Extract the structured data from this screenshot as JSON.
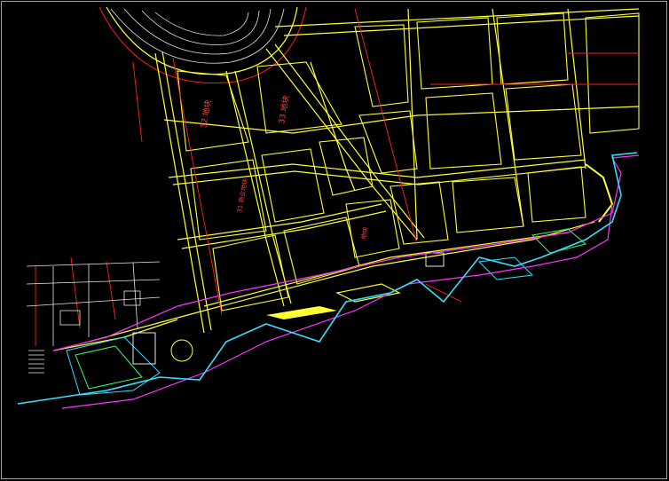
{
  "canvas": {
    "background": "#000000",
    "frame_color": "#00e5e5"
  },
  "colors": {
    "road_primary": "#ffff33",
    "road_secondary": "#e8e8e8",
    "plot_boundary": "#ff2020",
    "shoreline_outer": "#33e0ff",
    "shoreline_inner": "#ff33ff",
    "park_green": "#33ff66"
  },
  "labels": {
    "plot_32": "32 地块",
    "plot_33": "33 地块",
    "plot_center": "31 商业地块",
    "plot_small": "地块"
  }
}
